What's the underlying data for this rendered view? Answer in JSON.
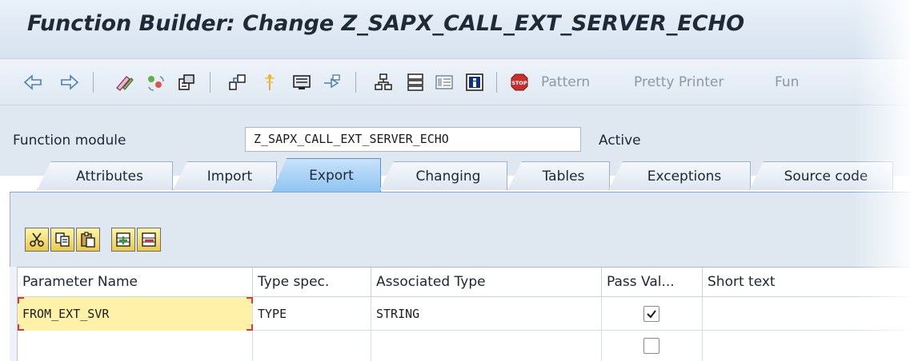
{
  "window": {
    "title": "Function Builder: Change Z_SAPX_CALL_EXT_SERVER_ECHO"
  },
  "toolbar": {
    "icons": [
      "back-icon",
      "forward-icon",
      "edit-icon",
      "activate-icon",
      "display-object-list-icon",
      "where-used-icon",
      "navigate-icon",
      "save-icon",
      "enhance-icon",
      "hierarchy-icon",
      "object-list-icon",
      "test-icon",
      "information-icon",
      "stop-icon"
    ],
    "pattern_label": "Pattern",
    "pretty_printer_label": "Pretty Printer",
    "more_label": "Fun"
  },
  "header": {
    "function_module_label": "Function module",
    "function_module_value": "Z_SAPX_CALL_EXT_SERVER_ECHO",
    "status": "Active"
  },
  "tabs": [
    {
      "label": "Attributes",
      "active": false
    },
    {
      "label": "Import",
      "active": false
    },
    {
      "label": "Export",
      "active": true
    },
    {
      "label": "Changing",
      "active": false
    },
    {
      "label": "Tables",
      "active": false
    },
    {
      "label": "Exceptions",
      "active": false
    },
    {
      "label": "Source code",
      "active": false
    }
  ],
  "grid_tools": [
    "cut-icon",
    "copy-icon",
    "paste-icon",
    "insert-row-icon",
    "delete-row-icon"
  ],
  "table": {
    "columns": [
      "Parameter Name",
      "Type spec.",
      "Associated Type",
      "Pass Val...",
      "Short text"
    ],
    "rows": [
      {
        "name": "FROM_EXT_SVR",
        "type_spec": "TYPE",
        "assoc_type": "STRING",
        "pass_value": true,
        "short_text": ""
      },
      {
        "name": "",
        "type_spec": "",
        "assoc_type": "",
        "pass_value": false,
        "short_text": ""
      }
    ]
  }
}
